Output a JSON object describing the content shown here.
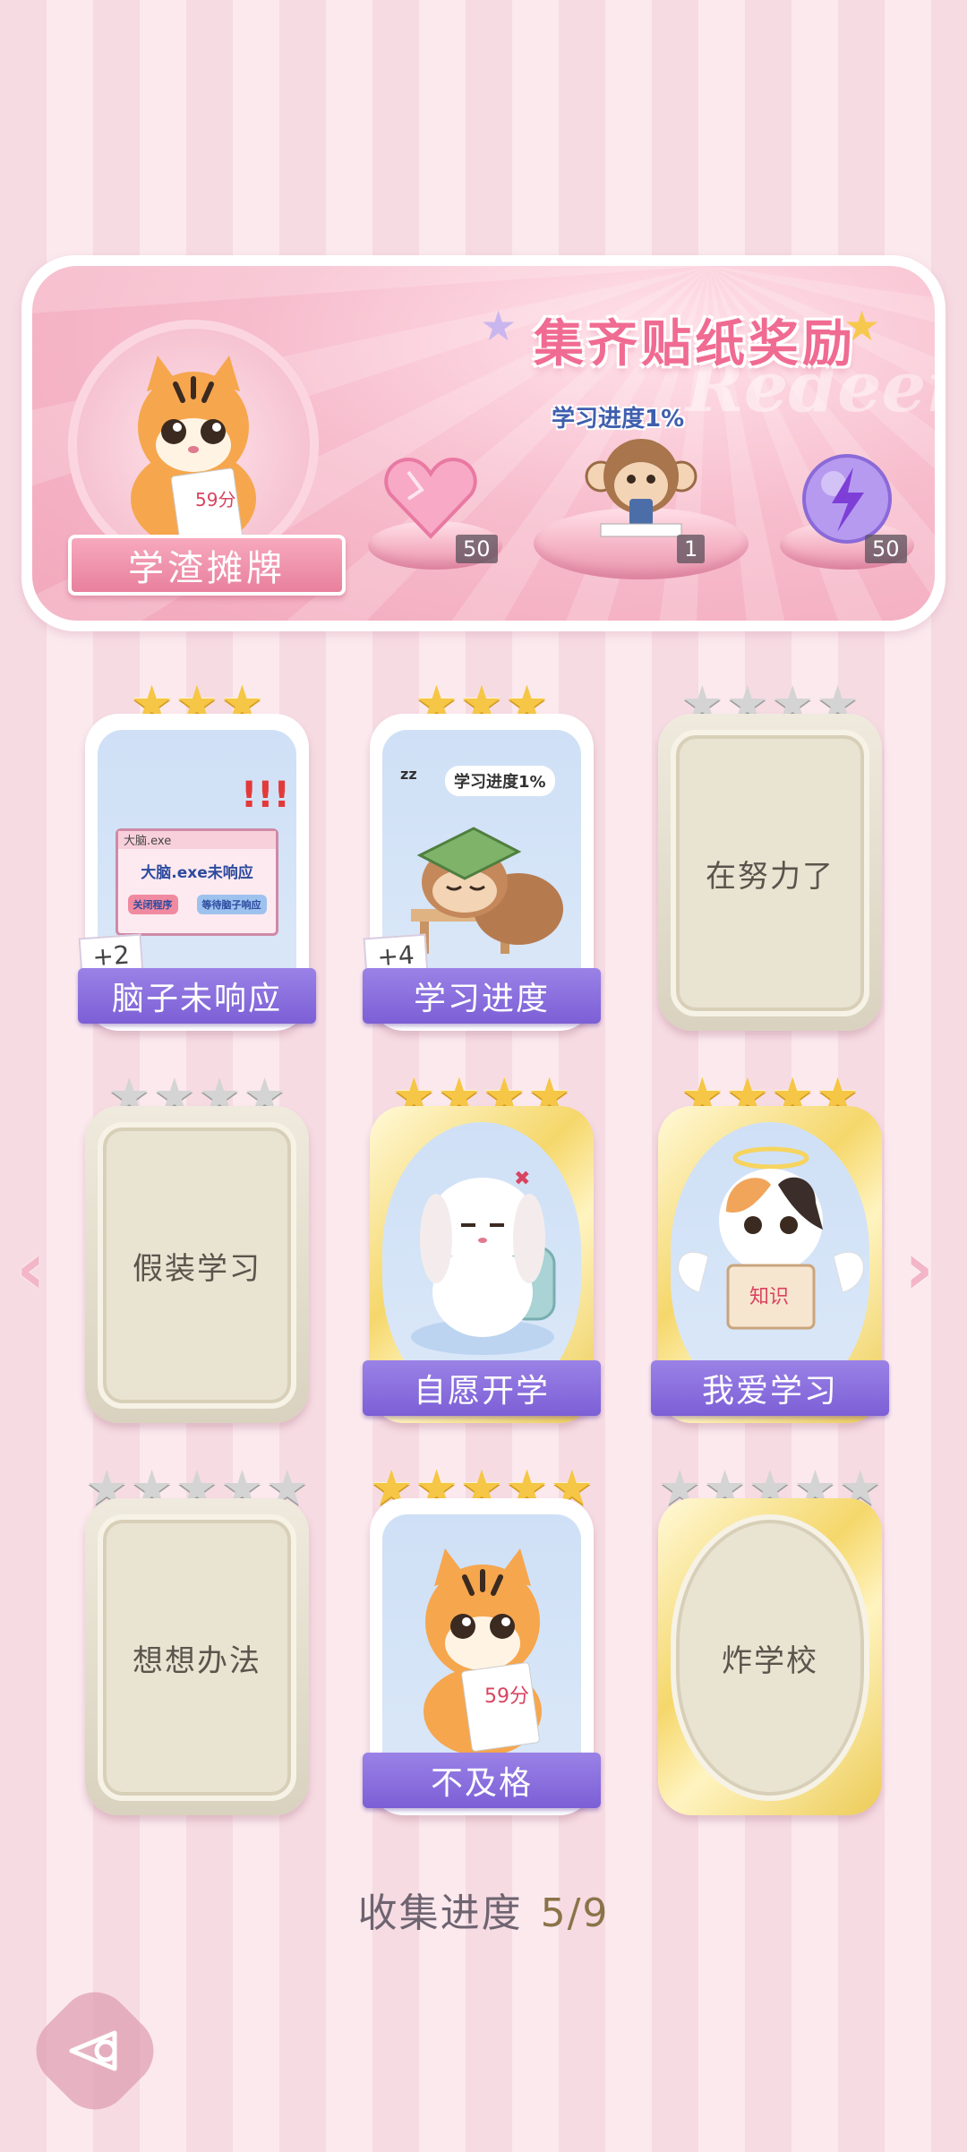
{
  "banner": {
    "title": "集齐贴纸奖励",
    "watermark": "Redeem",
    "nameplate": "学渣摊牌",
    "mini_progress": "学习进度1%",
    "avatar_paper": "59分",
    "rewards": [
      {
        "name": "heart-gem",
        "count": "50"
      },
      {
        "name": "monkey-sticker",
        "count": "1"
      },
      {
        "name": "energy-orb",
        "count": "50"
      }
    ]
  },
  "cards": [
    {
      "id": "brain",
      "label": "脑子未响应",
      "plus": "+2",
      "stars": 3,
      "unlocked": true,
      "popup": {
        "title": "大脑.exe",
        "message": "大脑.exe未响应",
        "btn1": "关闭程序",
        "btn2": "等待脑子响应",
        "marks": "!!!"
      }
    },
    {
      "id": "progress",
      "label": "学习进度",
      "plus": "+4",
      "stars": 3,
      "unlocked": true,
      "bubble": "学习进度1%",
      "zz": "zz"
    },
    {
      "id": "trying",
      "label": "在努力了",
      "stars": 4,
      "unlocked": false
    },
    {
      "id": "pretend",
      "label": "假装学习",
      "stars": 4,
      "unlocked": false
    },
    {
      "id": "voluntary",
      "label": "自愿开学",
      "stars": 4,
      "unlocked": true
    },
    {
      "id": "love",
      "label": "我爱学习",
      "stars": 4,
      "unlocked": true,
      "book": "知识"
    },
    {
      "id": "think",
      "label": "想想办法",
      "stars": 5,
      "unlocked": false
    },
    {
      "id": "fail",
      "label": "不及格",
      "stars": 5,
      "unlocked": true,
      "paper": "59分"
    },
    {
      "id": "bomb",
      "label": "炸学校",
      "stars": 5,
      "unlocked": false
    }
  ],
  "footer": {
    "progress_label": "收集进度",
    "progress_value": "5/9"
  },
  "colors": {
    "accent_pink": "#f06b92",
    "ribbon_purple": "#8a6fe0",
    "star_gold": "#f6c646",
    "star_grey": "#d4d4d4"
  }
}
